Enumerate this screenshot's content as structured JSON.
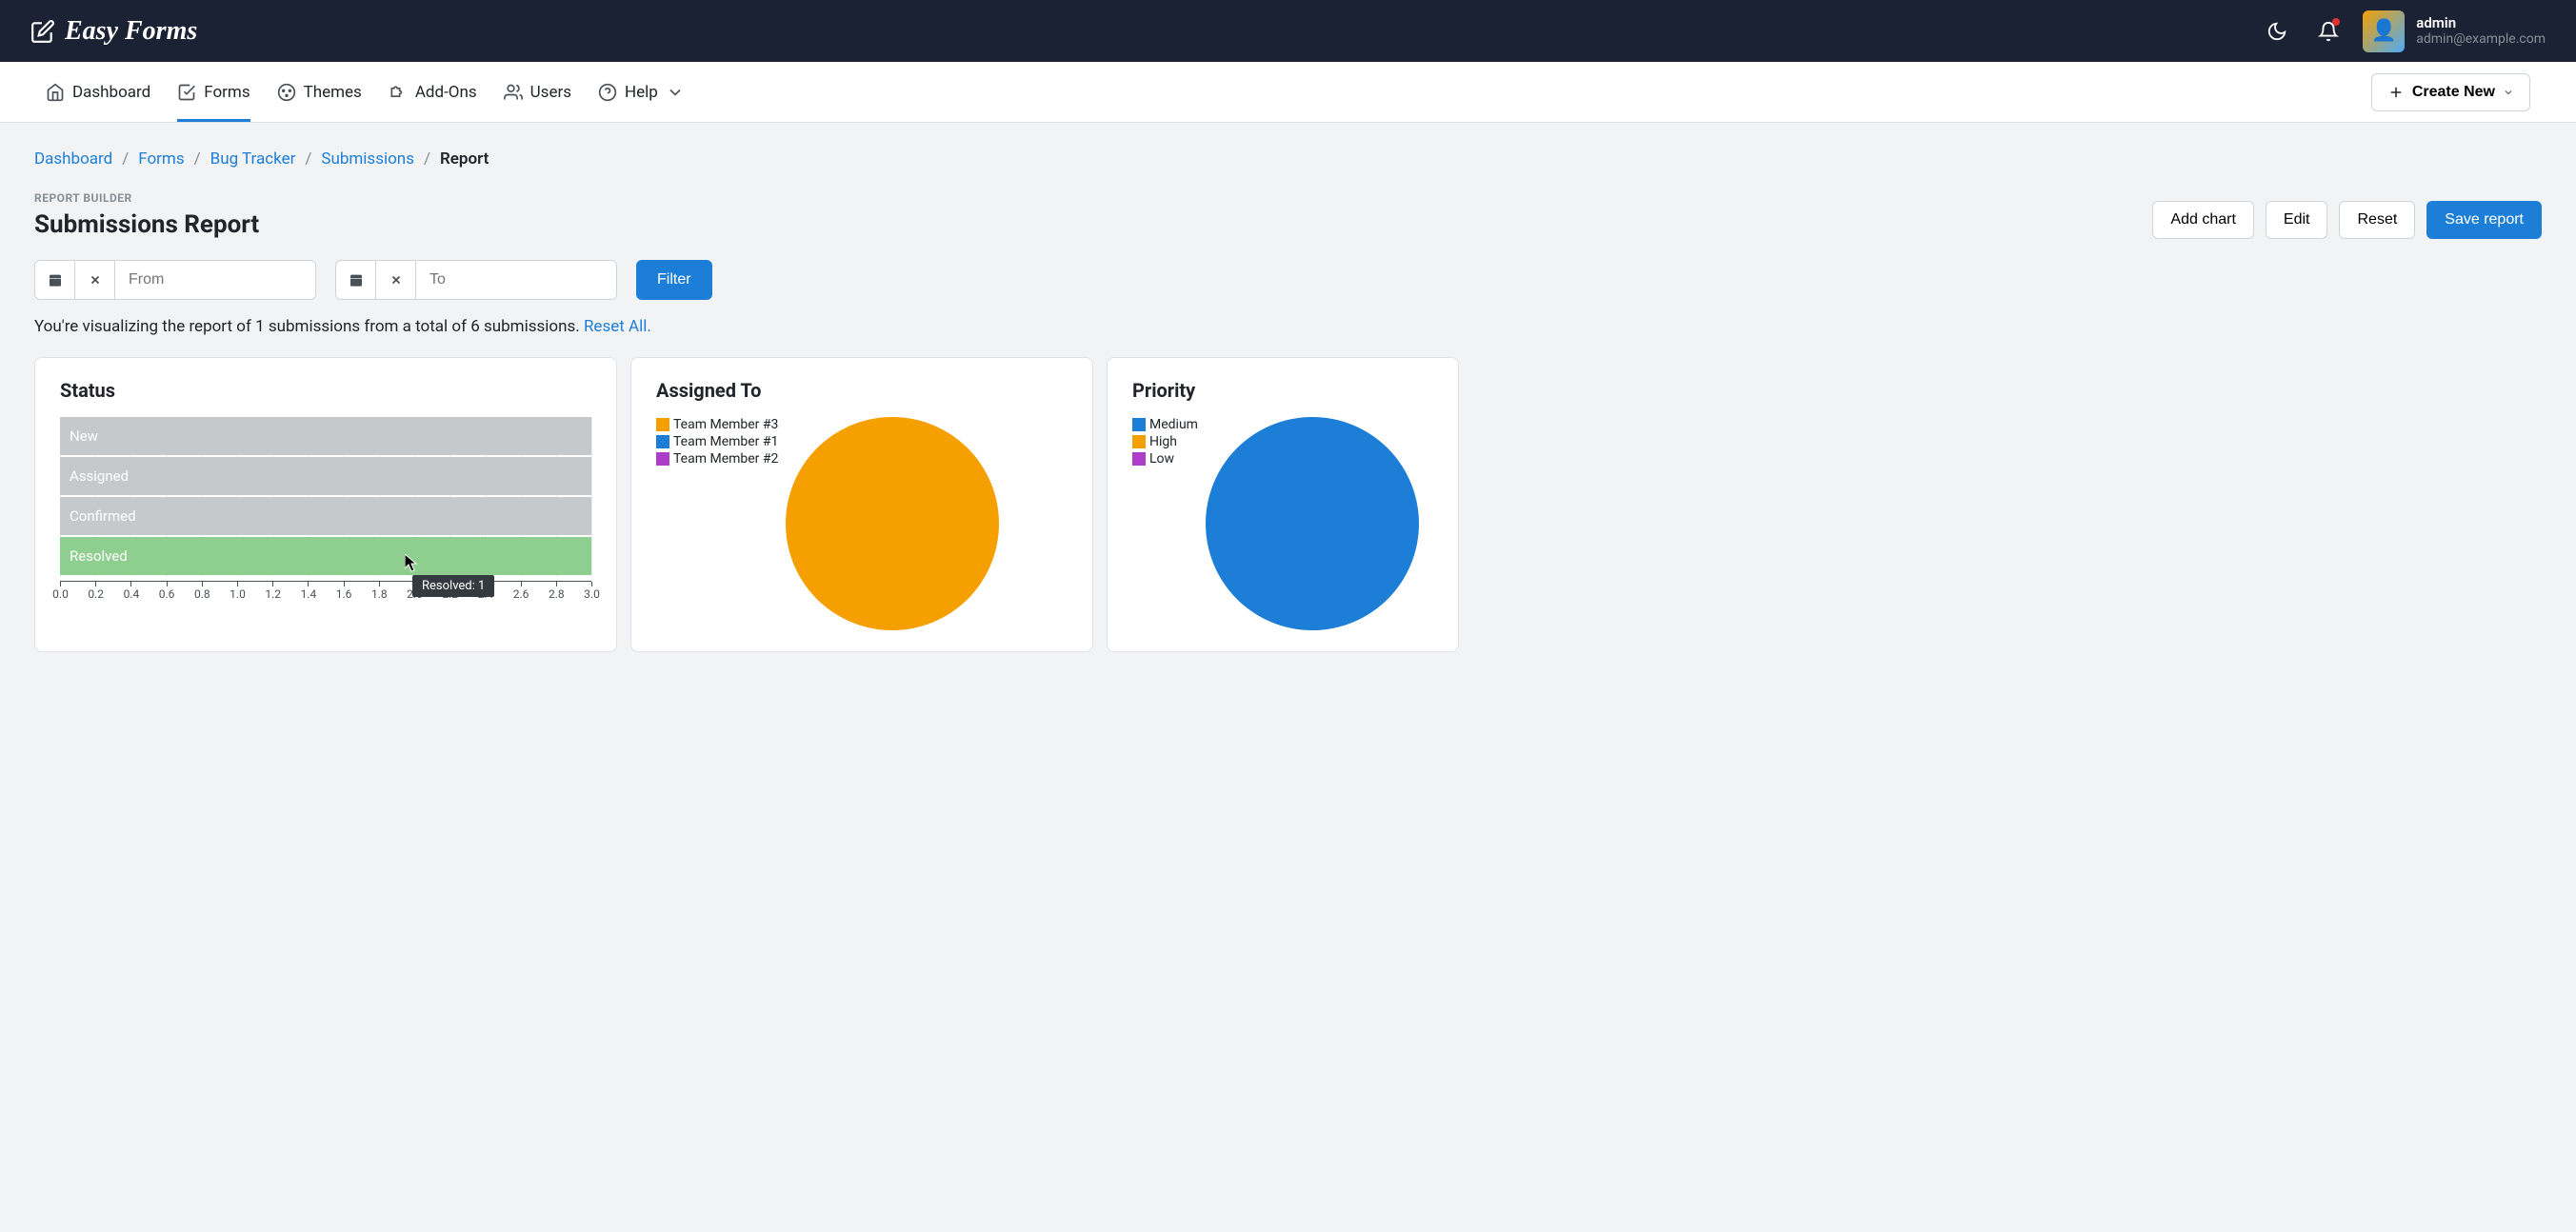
{
  "brand": "Easy Forms",
  "user": {
    "name": "admin",
    "email": "admin@example.com"
  },
  "nav": {
    "items": [
      {
        "label": "Dashboard"
      },
      {
        "label": "Forms"
      },
      {
        "label": "Themes"
      },
      {
        "label": "Add-Ons"
      },
      {
        "label": "Users"
      },
      {
        "label": "Help"
      }
    ],
    "create_label": "Create New"
  },
  "breadcrumb": {
    "items": [
      "Dashboard",
      "Forms",
      "Bug Tracker",
      "Submissions"
    ],
    "current": "Report"
  },
  "page": {
    "kicker": "REPORT BUILDER",
    "title": "Submissions Report",
    "actions": {
      "add_chart": "Add chart",
      "edit": "Edit",
      "reset": "Reset",
      "save": "Save report"
    }
  },
  "filters": {
    "from_placeholder": "From",
    "to_placeholder": "To",
    "filter_label": "Filter"
  },
  "summary": {
    "text": "You're visualizing the report of 1 submissions from a total of 6 submissions. ",
    "reset_all": "Reset All."
  },
  "chart_data": [
    {
      "type": "bar",
      "title": "Status",
      "orientation": "horizontal",
      "categories": [
        "New",
        "Assigned",
        "Confirmed",
        "Resolved"
      ],
      "values": [
        0,
        0,
        0,
        1
      ],
      "xlim": [
        0,
        3
      ],
      "x_ticks": [
        "0.0",
        "0.2",
        "0.4",
        "0.6",
        "0.8",
        "1.0",
        "1.2",
        "1.4",
        "1.6",
        "1.8",
        "2.0",
        "2.2",
        "2.4",
        "2.6",
        "2.8",
        "3.0"
      ],
      "tooltip": "Resolved: 1",
      "colors": {
        "empty": "#c5c9cc",
        "filled": "#8ece8e"
      }
    },
    {
      "type": "pie",
      "title": "Assigned To",
      "series": [
        {
          "name": "Team Member #3",
          "value": 1,
          "color": "#f59f00"
        },
        {
          "name": "Team Member #1",
          "value": 0,
          "color": "#1c7ed6"
        },
        {
          "name": "Team Member #2",
          "value": 0,
          "color": "#ae3ec9"
        }
      ]
    },
    {
      "type": "pie",
      "title": "Priority",
      "series": [
        {
          "name": "Medium",
          "value": 1,
          "color": "#1c7ed6"
        },
        {
          "name": "High",
          "value": 0,
          "color": "#f59f00"
        },
        {
          "name": "Low",
          "value": 0,
          "color": "#ae3ec9"
        }
      ]
    }
  ]
}
